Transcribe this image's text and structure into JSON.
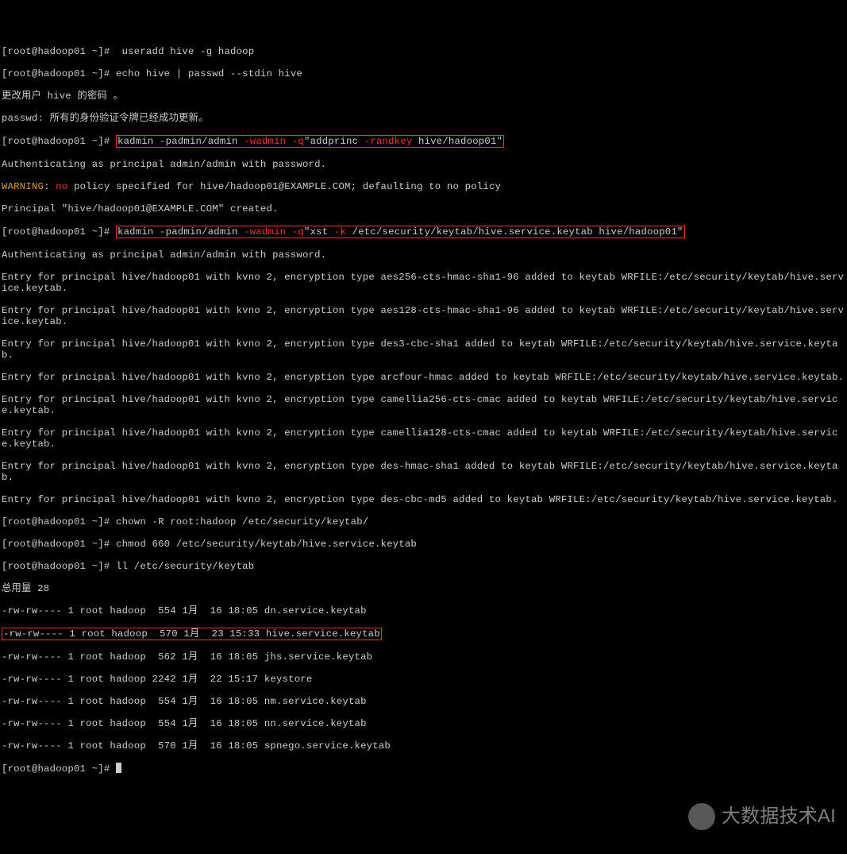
{
  "prompt1": {
    "pre": "[root@hadoop01 ~]#  ",
    "cmd": "useradd hive -g hadoop"
  },
  "prompt2": {
    "pre": "[root@hadoop01 ~]# ",
    "cmd": "echo hive | passwd --stdin hive"
  },
  "pw_line1": "更改用户 hive 的密码 。",
  "pw_line2": "passwd: 所有的身份验证令牌已经成功更新。",
  "prompt3": {
    "pre": "[root@hadoop01 ~]# ",
    "p1": "kadmin -padmin/admin ",
    "p2": "-wadmin -q",
    "p3": "\"addprinc ",
    "p4": "-randkey",
    "p5": " hive/hadoop01\""
  },
  "auth": "Authenticating as principal admin/admin with password.",
  "warn": {
    "w": "WARNING",
    "sep": ": ",
    "n": "no",
    "rest": " policy specified for hive/hadoop01@EXAMPLE.COM; defaulting to no policy"
  },
  "princ": "Principal \"hive/hadoop01@EXAMPLE.COM\" created.",
  "prompt4": {
    "pre": "[root@hadoop01 ~]# ",
    "p1": "kadmin -padmin/admin ",
    "p2": "-wadmin -q",
    "p3": "\"xst ",
    "p4": "-k",
    "p5": " /etc/security/keytab/hive.service.keytab hive/hadoop01\""
  },
  "entries": [
    "Entry for principal hive/hadoop01 with kvno 2, encryption type aes256-cts-hmac-sha1-96 added to keytab WRFILE:/etc/security/keytab/hive.service.keytab.",
    "Entry for principal hive/hadoop01 with kvno 2, encryption type aes128-cts-hmac-sha1-96 added to keytab WRFILE:/etc/security/keytab/hive.service.keytab.",
    "Entry for principal hive/hadoop01 with kvno 2, encryption type des3-cbc-sha1 added to keytab WRFILE:/etc/security/keytab/hive.service.keytab.",
    "Entry for principal hive/hadoop01 with kvno 2, encryption type arcfour-hmac added to keytab WRFILE:/etc/security/keytab/hive.service.keytab.",
    "Entry for principal hive/hadoop01 with kvno 2, encryption type camellia256-cts-cmac added to keytab WRFILE:/etc/security/keytab/hive.service.keytab.",
    "Entry for principal hive/hadoop01 with kvno 2, encryption type camellia128-cts-cmac added to keytab WRFILE:/etc/security/keytab/hive.service.keytab.",
    "Entry for principal hive/hadoop01 with kvno 2, encryption type des-hmac-sha1 added to keytab WRFILE:/etc/security/keytab/hive.service.keytab.",
    "Entry for principal hive/hadoop01 with kvno 2, encryption type des-cbc-md5 added to keytab WRFILE:/etc/security/keytab/hive.service.keytab."
  ],
  "prompt5": {
    "pre": "[root@hadoop01 ~]# ",
    "cmd": "chown -R root:hadoop /etc/security/keytab/"
  },
  "prompt6": {
    "pre": "[root@hadoop01 ~]# ",
    "cmd": "chmod 660 /etc/security/keytab/hive.service.keytab"
  },
  "prompt7": {
    "pre": "[root@hadoop01 ~]# ",
    "cmd": "ll /etc/security/keytab"
  },
  "total": "总用量 28",
  "ll": [
    "-rw-rw---- 1 root hadoop  554 1月  16 18:05 dn.service.keytab",
    "-rw-rw---- 1 root hadoop  570 1月  23 15:33 hive.service.keytab",
    "-rw-rw---- 1 root hadoop  562 1月  16 18:05 jhs.service.keytab",
    "-rw-rw---- 1 root hadoop 2242 1月  22 15:17 keystore",
    "-rw-rw---- 1 root hadoop  554 1月  16 18:05 nm.service.keytab",
    "-rw-rw---- 1 root hadoop  554 1月  16 18:05 nn.service.keytab",
    "-rw-rw---- 1 root hadoop  570 1月  16 18:05 spnego.service.keytab"
  ],
  "prompt8": "[root@hadoop01 ~]# ",
  "watermark": "大数据技术AI"
}
